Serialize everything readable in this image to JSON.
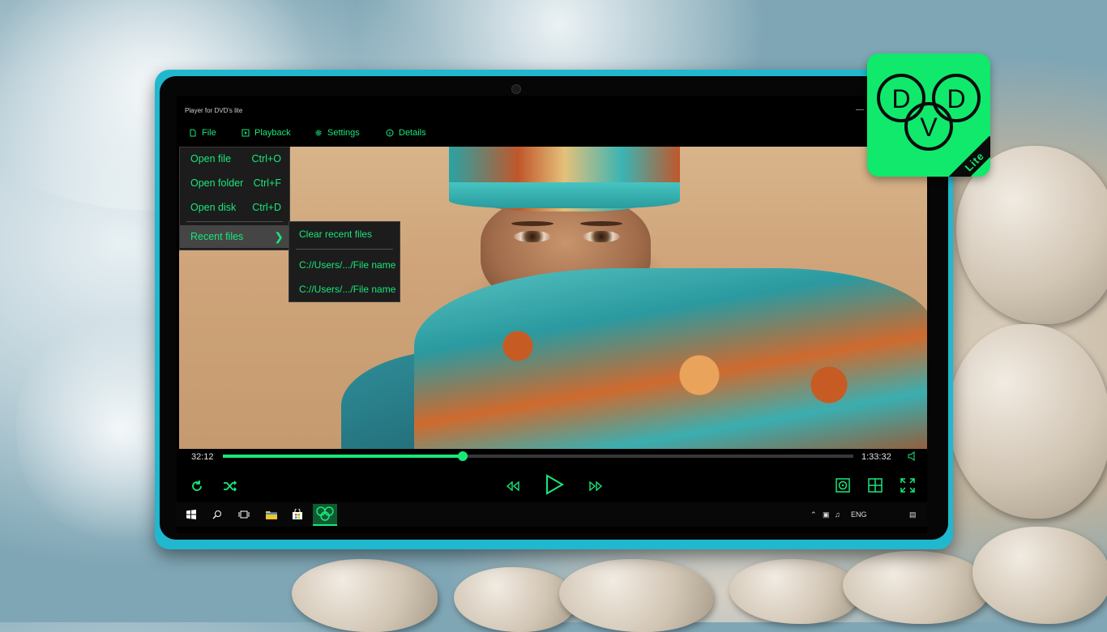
{
  "app": {
    "title": "Player for DVD's lite"
  },
  "menu": {
    "items": [
      {
        "label": "File",
        "icon": "file-icon"
      },
      {
        "label": "Playback",
        "icon": "playback-icon"
      },
      {
        "label": "Settings",
        "icon": "gear-icon"
      },
      {
        "label": "Details",
        "icon": "info-icon"
      }
    ]
  },
  "file_menu": {
    "items": [
      {
        "label": "Open file",
        "shortcut": "Ctrl+O"
      },
      {
        "label": "Open folder",
        "shortcut": "Ctrl+F"
      },
      {
        "label": "Open disk",
        "shortcut": "Ctrl+D"
      }
    ],
    "recent_label": "Recent files"
  },
  "recent_menu": {
    "clear_label": "Clear recent files",
    "files": [
      "C://Users/.../File name",
      "C://Users/.../File name"
    ]
  },
  "player": {
    "current_time": "32:12",
    "total_time": "1:33:32",
    "progress": 0.38
  },
  "taskbar": {
    "language": "ENG"
  },
  "logo": {
    "letters": [
      "D",
      "V",
      "D"
    ],
    "badge": "Lite"
  },
  "colors": {
    "accent": "#18e87a",
    "tablet": "#20b8cf",
    "logo_bg": "#10e96b"
  }
}
